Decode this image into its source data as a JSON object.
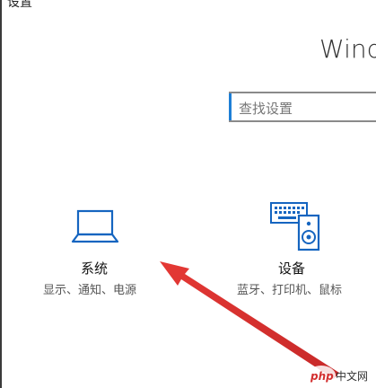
{
  "window": {
    "title": "设置"
  },
  "header": {
    "heading": "Windows"
  },
  "search": {
    "placeholder": "查找设置"
  },
  "tiles": [
    {
      "label": "系统",
      "description": "显示、通知、电源",
      "icon": "laptop-icon"
    },
    {
      "label": "设备",
      "description": "蓝牙、打印机、鼠标",
      "icon": "keyboard-speaker-icon"
    }
  ],
  "watermark": {
    "text": "php 中文网"
  },
  "colors": {
    "accent": "#1e7fd6",
    "icon_blue": "#1565c0",
    "arrow_red": "#e53935"
  }
}
